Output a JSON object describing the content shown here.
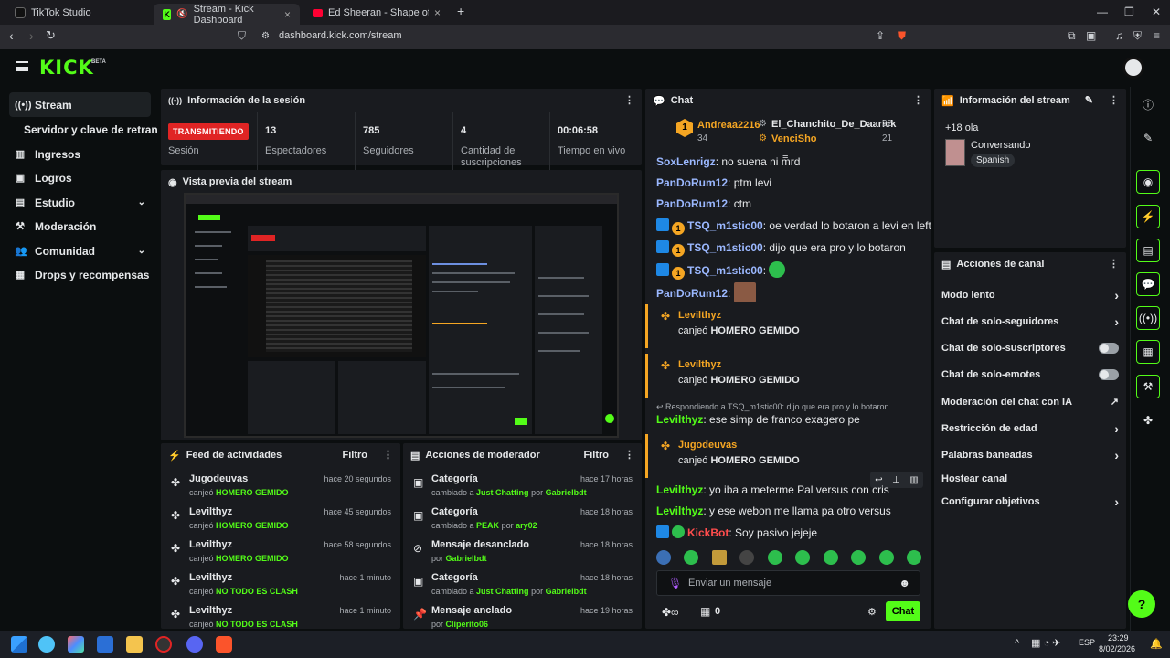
{
  "browser": {
    "tabs": [
      {
        "title": "TikTok Studio"
      },
      {
        "title": "Stream - Kick Dashboard"
      },
      {
        "title": "Ed Sheeran - Shape of You [Lyrics"
      }
    ],
    "url": "dashboard.kick.com/stream"
  },
  "header": {
    "logo": "KICK",
    "beta": "BETA"
  },
  "sidebar": {
    "items": [
      {
        "label": "Stream",
        "icon": "stream-icon"
      },
      {
        "label": "Servidor y clave de retransmisión"
      },
      {
        "label": "Ingresos",
        "icon": "revenue-icon"
      },
      {
        "label": "Logros",
        "icon": "trophy-icon"
      },
      {
        "label": "Estudio",
        "icon": "studio-icon"
      },
      {
        "label": "Moderación",
        "icon": "hammer-icon"
      },
      {
        "label": "Comunidad",
        "icon": "community-icon"
      },
      {
        "label": "Drops y recompensas",
        "icon": "gift-icon"
      }
    ]
  },
  "session": {
    "title": "Información de la sesión",
    "live_badge": "TRANSMITIENDO",
    "stats": [
      {
        "value": "",
        "label": "Sesión"
      },
      {
        "value": "13",
        "label": "Espectadores"
      },
      {
        "value": "785",
        "label": "Seguidores"
      },
      {
        "value": "4",
        "label": "Cantidad de suscripciones"
      },
      {
        "value": "00:06:58",
        "label": "Tiempo en vivo"
      }
    ]
  },
  "preview": {
    "title": "Vista previa del stream"
  },
  "feed": {
    "title": "Feed de actividades",
    "filter": "Filtro",
    "rows": [
      {
        "name": "Jugodeuvas",
        "action": "canjeó",
        "item": "HOMERO GEMIDO",
        "time": "hace 20 segundos"
      },
      {
        "name": "Levilthyz",
        "action": "canjeó",
        "item": "HOMERO GEMIDO",
        "time": "hace 45 segundos"
      },
      {
        "name": "Levilthyz",
        "action": "canjeó",
        "item": "HOMERO GEMIDO",
        "time": "hace 58 segundos"
      },
      {
        "name": "Levilthyz",
        "action": "canjeó",
        "item": "NO TODO ES CLASH",
        "time": "hace 1 minuto"
      },
      {
        "name": "Levilthyz",
        "action": "canjeó",
        "item": "NO TODO ES CLASH",
        "time": "hace 1 minuto"
      }
    ]
  },
  "modactions": {
    "title": "Acciones de moderador",
    "filter": "Filtro",
    "rows": [
      {
        "name": "Categoría",
        "pre": "cambiado a",
        "item": "Just Chatting",
        "by": "por",
        "who": "Gabrielbdt",
        "time": "hace 17 horas"
      },
      {
        "name": "Categoría",
        "pre": "cambiado a",
        "item": "PEAK",
        "by": "por",
        "who": "ary02",
        "time": "hace 18 horas"
      },
      {
        "name": "Mensaje desanclado",
        "pre": "por",
        "item": "",
        "by": "",
        "who": "Gabrielbdt",
        "time": "hace 18 horas"
      },
      {
        "name": "Categoría",
        "pre": "cambiado a",
        "item": "Just Chatting",
        "by": "por",
        "who": "Gabrielbdt",
        "time": "hace 18 horas"
      },
      {
        "name": "Mensaje anclado",
        "pre": "por",
        "item": "",
        "by": "",
        "who": "Cliperito06",
        "time": "hace 19 horas"
      }
    ]
  },
  "chat": {
    "title": "Chat",
    "leaderboard": [
      {
        "rank": "1",
        "name": "Andreaa2216",
        "score": "34"
      },
      {
        "name": "El_Chanchito_De_Daarick",
        "score": "22"
      },
      {
        "name": "VenciSho",
        "score": "21"
      }
    ],
    "messages": [
      {
        "user": "SoxLenrigz",
        "text": "no suena ni mrd"
      },
      {
        "user": "PanDoRum12",
        "text": "ptm levi"
      },
      {
        "user": "PanDoRum12",
        "text": "ctm"
      },
      {
        "user": "TSQ_m1stic00",
        "text": "oe verdad lo botaron a levi en left"
      },
      {
        "user": "TSQ_m1stic00",
        "text": "dijo que era pro y lo botaron"
      },
      {
        "user": "TSQ_m1stic00",
        "text": ""
      },
      {
        "user": "PanDoRum12",
        "text": ""
      }
    ],
    "redeems": [
      {
        "user": "Levilthyz",
        "action": "canjeó",
        "item": "HOMERO GEMIDO"
      },
      {
        "user": "Levilthyz",
        "action": "canjeó",
        "item": "HOMERO GEMIDO"
      },
      {
        "user": "Jugodeuvas",
        "action": "canjeó",
        "item": "HOMERO GEMIDO"
      }
    ],
    "reply_to": "Respondiendo a TSQ_m1stic00: dijo que era pro y lo botaron",
    "messages2": [
      {
        "user": "Levilthyz",
        "text": "ese simp de franco exagero pe"
      },
      {
        "user": "Levilthyz",
        "text": "yo iba a meterme Pal versus con cris"
      },
      {
        "user": "Levilthyz",
        "text": "y ese webon me llama pa otro versus"
      },
      {
        "user": "KickBot",
        "text": "Soy pasivo jejeje"
      }
    ],
    "input_placeholder": "Enviar un mensaje",
    "points": "0",
    "send": "Chat"
  },
  "streaminfo": {
    "title": "Información del stream",
    "tag": "+18 ola",
    "category": "Conversando",
    "language": "Spanish"
  },
  "channel_actions": {
    "title": "Acciones de canal",
    "rows": [
      {
        "label": "Modo lento",
        "control": "arrow"
      },
      {
        "label": "Chat de solo-seguidores",
        "control": "arrow"
      },
      {
        "label": "Chat de solo-suscriptores",
        "control": "toggle"
      },
      {
        "label": "Chat de solo-emotes",
        "control": "toggle"
      },
      {
        "label": "Moderación del chat con IA",
        "control": "external"
      },
      {
        "label": "Restricción de edad",
        "control": "arrow"
      },
      {
        "label": "Palabras baneadas",
        "control": "arrow"
      },
      {
        "label": "Hostear canal",
        "control": "none"
      },
      {
        "label": "Configurar objetivos",
        "control": "arrow"
      }
    ]
  },
  "taskbar": {
    "lang": "ESP",
    "time": "23:29",
    "date": "8/02/2026"
  },
  "colors": {
    "brand": "#53fc18",
    "live": "#e02424",
    "panel": "#191b1f",
    "bg": "#0b0e0f"
  }
}
